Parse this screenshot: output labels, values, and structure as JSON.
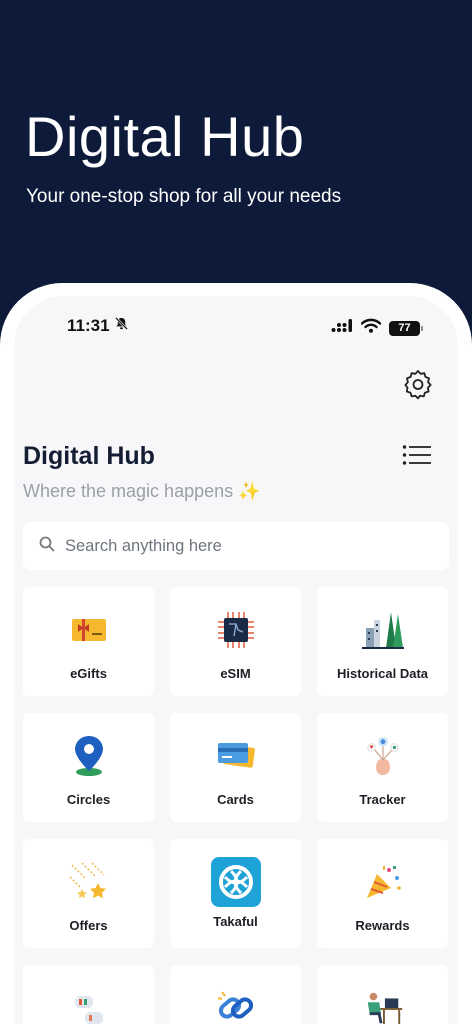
{
  "hero": {
    "title": "Digital Hub",
    "subtitle": "Your one-stop shop for all your needs"
  },
  "status_bar": {
    "time": "11:31",
    "battery": "77",
    "icons": [
      "bell-slash-icon",
      "signal-icon",
      "wifi-icon",
      "battery-icon"
    ]
  },
  "page": {
    "title": "Digital Hub",
    "subtitle": "Where the magic happens ✨"
  },
  "search": {
    "placeholder": "Search anything here"
  },
  "tiles": [
    {
      "label": "eGifts",
      "icon": "gift-card-icon"
    },
    {
      "label": "eSIM",
      "icon": "esim-chip-icon"
    },
    {
      "label": "Historical Data",
      "icon": "historical-data-icon"
    },
    {
      "label": "Circles",
      "icon": "map-pin-icon"
    },
    {
      "label": "Cards",
      "icon": "credit-cards-icon"
    },
    {
      "label": "Tracker",
      "icon": "tracker-icon"
    },
    {
      "label": "Offers",
      "icon": "shooting-stars-icon"
    },
    {
      "label": "Takaful",
      "icon": "takaful-logo-icon"
    },
    {
      "label": "Rewards",
      "icon": "party-popper-icon"
    },
    {
      "label": "",
      "icon": "chat-bubbles-icon"
    },
    {
      "label": "",
      "icon": "chain-link-icon"
    },
    {
      "label": "",
      "icon": "person-at-desk-icon"
    }
  ],
  "colors": {
    "hero_bg": "#0d1a3a",
    "screen_bg": "#f7f7f9",
    "tile_bg": "#ffffff",
    "title_text": "#141d33",
    "muted_text": "#9aa0a8"
  }
}
